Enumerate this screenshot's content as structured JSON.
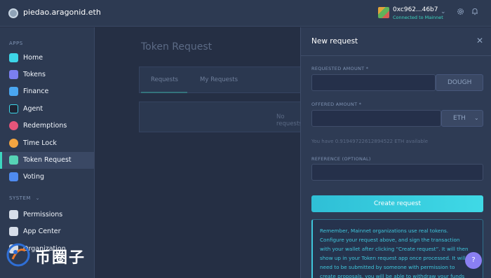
{
  "header": {
    "org_name": "piedao.aragonid.eth",
    "account": "0xc962...46b7",
    "network_status": "Connected to Mainnet",
    "icons": [
      "org-logo-icon",
      "identicon-icon",
      "chevron-down-icon",
      "gear-icon",
      "bell-icon"
    ]
  },
  "sidebar": {
    "apps_label": "APPS",
    "system_label": "SYSTEM",
    "items": [
      {
        "label": "Home",
        "icon": "home-icon",
        "color": "#3dd6e8"
      },
      {
        "label": "Tokens",
        "icon": "tokens-icon",
        "color": "#7a7ff0"
      },
      {
        "label": "Finance",
        "icon": "finance-icon",
        "color": "#4aa6f0"
      },
      {
        "label": "Agent",
        "icon": "agent-icon",
        "color": "#1e2333"
      },
      {
        "label": "Redemptions",
        "icon": "redemptions-icon",
        "color": "#e5557a"
      },
      {
        "label": "Time Lock",
        "icon": "time-lock-icon",
        "color": "#f3a541"
      },
      {
        "label": "Token Request",
        "icon": "token-request-icon",
        "color": "#56d3b5"
      },
      {
        "label": "Voting",
        "icon": "voting-icon",
        "color": "#4f8bf0"
      }
    ],
    "system_items": [
      {
        "label": "Permissions",
        "icon": "permissions-icon"
      },
      {
        "label": "App Center",
        "icon": "app-center-icon"
      },
      {
        "label": "Organization",
        "icon": "organization-icon"
      }
    ],
    "active": "Token Request"
  },
  "main": {
    "title": "Token Request",
    "tabs": [
      "Requests",
      "My Requests"
    ],
    "empty_text": "No requests"
  },
  "panel": {
    "title": "New request",
    "requested_label": "REQUESTED AMOUNT *",
    "requested_value": "",
    "requested_token": "DOUGH",
    "offered_label": "OFFERED AMOUNT *",
    "offered_value": "",
    "offered_token": "ETH",
    "available_text": "You have 0.919497226128945​22 ETH available",
    "reference_label": "REFERENCE (OPTIONAL)",
    "reference_value": "",
    "create_button": "Create request",
    "info_lines": [
      "Remember, Mainnet organizations use real tokens.",
      "Configure your request above, and sign the transaction",
      "with your wallet after clicking “Create request”. It will then",
      "show up in your Token request app once processed. It will",
      "need to be submitted by someone with permission to",
      "create proposals, you will be able to withdraw your funds"
    ]
  },
  "help": {
    "label": "?"
  },
  "watermark": {
    "text": "币圈子"
  }
}
